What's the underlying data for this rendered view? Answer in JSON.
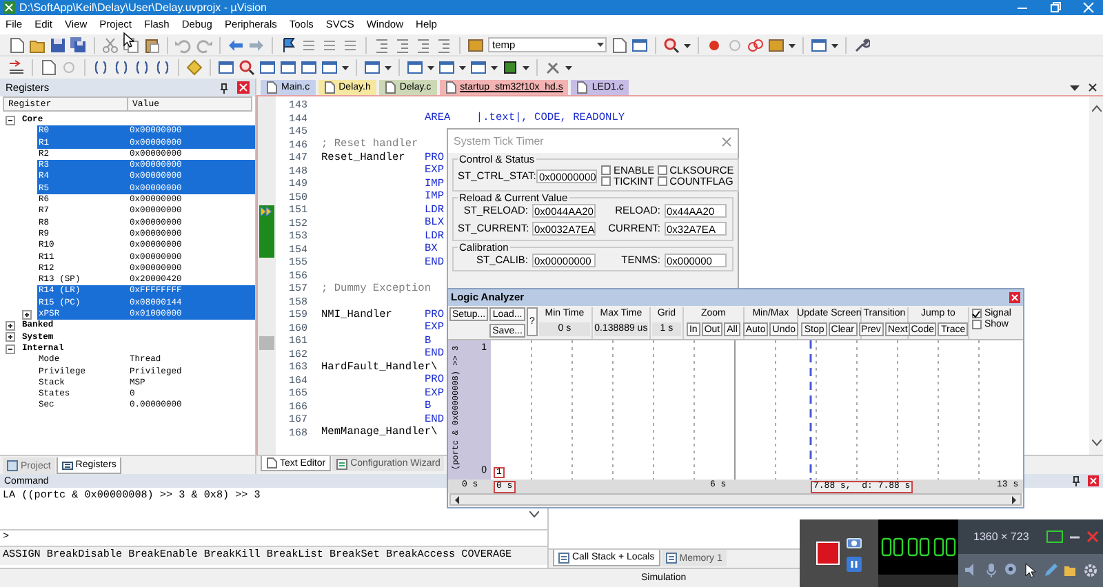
{
  "window": {
    "title": "D:\\SoftApp\\Keil\\Delay\\User\\Delay.uvprojx - µVision"
  },
  "menu": [
    "File",
    "Edit",
    "View",
    "Project",
    "Flash",
    "Debug",
    "Peripherals",
    "Tools",
    "SVCS",
    "Window",
    "Help"
  ],
  "toolbar": {
    "target": "temp"
  },
  "registers_panel": {
    "title": "Registers",
    "columns": [
      "Register",
      "Value"
    ],
    "tree": [
      {
        "name": "Core",
        "expanded": true,
        "selected": false,
        "children": [
          {
            "name": "R0",
            "value": "0x00000000",
            "selected": true
          },
          {
            "name": "R1",
            "value": "0x00000000",
            "selected": true
          },
          {
            "name": "R2",
            "value": "0x00000000",
            "selected": false
          },
          {
            "name": "R3",
            "value": "0x00000000",
            "selected": true
          },
          {
            "name": "R4",
            "value": "0x00000000",
            "selected": true
          },
          {
            "name": "R5",
            "value": "0x00000000",
            "selected": true
          },
          {
            "name": "R6",
            "value": "0x00000000",
            "selected": false
          },
          {
            "name": "R7",
            "value": "0x00000000",
            "selected": false
          },
          {
            "name": "R8",
            "value": "0x00000000",
            "selected": false
          },
          {
            "name": "R9",
            "value": "0x00000000",
            "selected": false
          },
          {
            "name": "R10",
            "value": "0x00000000",
            "selected": false
          },
          {
            "name": "R11",
            "value": "0x00000000",
            "selected": false
          },
          {
            "name": "R12",
            "value": "0x00000000",
            "selected": false
          },
          {
            "name": "R13 (SP)",
            "value": "0x20000420",
            "selected": false
          },
          {
            "name": "R14 (LR)",
            "value": "0xFFFFFFFF",
            "selected": true
          },
          {
            "name": "R15 (PC)",
            "value": "0x08000144",
            "selected": true
          },
          {
            "name": "xPSR",
            "value": "0x01000000",
            "selected": true,
            "expanded": false
          }
        ]
      },
      {
        "name": "Banked",
        "expanded": false,
        "selected": false
      },
      {
        "name": "System",
        "expanded": false,
        "selected": false
      },
      {
        "name": "Internal",
        "expanded": true,
        "selected": false,
        "children": [
          {
            "name": "Mode",
            "value": "Thread",
            "selected": false
          },
          {
            "name": "Privilege",
            "value": "Privileged",
            "selected": false
          },
          {
            "name": "Stack",
            "value": "MSP",
            "selected": false
          },
          {
            "name": "States",
            "value": "0",
            "selected": false
          },
          {
            "name": "Sec",
            "value": "0.00000000",
            "selected": false
          }
        ]
      }
    ],
    "tabs": [
      {
        "label": "Project",
        "selected": false
      },
      {
        "label": "Registers",
        "selected": true
      }
    ]
  },
  "editor": {
    "tabs": [
      {
        "label": "Main.c",
        "color": "#c5d1ec",
        "selected": false
      },
      {
        "label": "Delay.h",
        "color": "#f6e7a1",
        "selected": false
      },
      {
        "label": "Delay.c",
        "color": "#cdd8b6",
        "selected": false
      },
      {
        "label": "startup_stm32f10x_hd.s",
        "color": "#f3b3b3",
        "selected": true
      },
      {
        "label": "LED1.c",
        "color": "#c7bce6",
        "selected": false
      }
    ],
    "lines": [
      {
        "number": "143",
        "kind": "plain"
      },
      {
        "number": "144",
        "kind": "plain",
        "code": "AREA    |.text|, CODE, READONLY"
      },
      {
        "number": "145",
        "kind": "plain"
      },
      {
        "number": "146",
        "kind": "plain",
        "comment": "; Reset handler"
      },
      {
        "number": "147",
        "kind": "plain",
        "label": "Reset_Handler",
        "code": "PRO"
      },
      {
        "number": "148",
        "kind": "plain",
        "code": "EXP"
      },
      {
        "number": "149",
        "kind": "plain",
        "code": "IMP"
      },
      {
        "number": "150",
        "kind": "plain",
        "code": "IMP"
      },
      {
        "number": "151",
        "kind": "current",
        "code": "LDR"
      },
      {
        "number": "152",
        "kind": "executed",
        "code": "BLX"
      },
      {
        "number": "153",
        "kind": "executed",
        "code": "LDR"
      },
      {
        "number": "154",
        "kind": "executed",
        "code": "BX"
      },
      {
        "number": "155",
        "kind": "plain",
        "code": "END"
      },
      {
        "number": "156",
        "kind": "plain"
      },
      {
        "number": "157",
        "kind": "plain",
        "comment": "; Dummy Exception"
      },
      {
        "number": "158",
        "kind": "plain"
      },
      {
        "number": "159",
        "kind": "plain",
        "label": "NMI_Handler",
        "code": "PRO"
      },
      {
        "number": "160",
        "kind": "plain",
        "code": "EXP"
      },
      {
        "number": "161",
        "kind": "unexecuted",
        "code": "B"
      },
      {
        "number": "162",
        "kind": "plain",
        "code": "END"
      },
      {
        "number": "163",
        "kind": "plain",
        "label": "HardFault_Handler\\"
      },
      {
        "number": "164",
        "kind": "plain",
        "code": "PRO"
      },
      {
        "number": "165",
        "kind": "plain",
        "code": "EXP"
      },
      {
        "number": "166",
        "kind": "plain",
        "code": "B"
      },
      {
        "number": "167",
        "kind": "plain",
        "code": "END"
      },
      {
        "number": "168",
        "kind": "plain",
        "label": "MemManage_Handler\\"
      }
    ],
    "bottom_tabs": [
      {
        "label": "Text Editor",
        "selected": true
      },
      {
        "label": "Configuration Wizard",
        "selected": false
      }
    ]
  },
  "systick_dialog": {
    "title": "System Tick Timer",
    "control_status": {
      "title": "Control & Status",
      "label": "ST_CTRL_STAT:",
      "value": "0x00000000",
      "flags": [
        {
          "label": "ENABLE",
          "checked": false
        },
        {
          "label": "CLKSOURCE",
          "checked": false
        },
        {
          "label": "TICKINT",
          "checked": false
        },
        {
          "label": "COUNTFLAG",
          "checked": false
        }
      ]
    },
    "reload_current": {
      "title": "Reload & Current Value",
      "fields": [
        {
          "label": "ST_RELOAD:",
          "value": "0x0044AA20"
        },
        {
          "label": "RELOAD:",
          "value": "0x44AA20"
        },
        {
          "label": "ST_CURRENT:",
          "value": "0x0032A7EA"
        },
        {
          "label": "CURRENT:",
          "value": "0x32A7EA"
        }
      ]
    },
    "calibration": {
      "title": "Calibration",
      "fields": [
        {
          "label": "ST_CALIB:",
          "value": "0x00000000"
        },
        {
          "label": "TENMS:",
          "value": "0x000000"
        }
      ]
    }
  },
  "logic_analyzer": {
    "title": "Logic Analyzer",
    "setup": "Setup...",
    "load": "Load...",
    "save": "Save...",
    "help": "?",
    "readouts": [
      {
        "label": "Min Time",
        "value": "0 s"
      },
      {
        "label": "Max Time",
        "value": "0.138889 us"
      },
      {
        "label": "Grid",
        "value": "1 s"
      }
    ],
    "button_groups": [
      {
        "label": "Zoom",
        "buttons": [
          "In",
          "Out",
          "All"
        ]
      },
      {
        "label": "Min/Max",
        "buttons": [
          "Auto",
          "Undo"
        ]
      },
      {
        "label": "Update Screen",
        "buttons": [
          "Stop",
          "Clear"
        ]
      },
      {
        "label": "Transition",
        "buttons": [
          "Prev",
          "Next"
        ]
      },
      {
        "label": "Jump to",
        "buttons": [
          "Code",
          "Trace"
        ]
      }
    ],
    "options": [
      {
        "label": "Signal",
        "checked": true
      },
      {
        "label": "Show",
        "checked": false
      }
    ],
    "signal": {
      "name": "(portc & 0x00000008) >> 3",
      "max": "1",
      "min": "0"
    },
    "marker": "1",
    "axis": {
      "start": "0 s",
      "cursor_start": "0 s",
      "middle": "6 s",
      "cursor": "7.88 s,  d: 7.88 s",
      "end": "13 s"
    }
  },
  "command": {
    "title": "Command",
    "output": "LA ((portc & 0x00000008) >> 3 & 0x8) >> 3",
    "prompt": ">",
    "hints": "ASSIGN BreakDisable BreakEnable BreakKill BreakList BreakSet BreakAccess COVERAGE"
  },
  "watch_panel": {
    "tabs": [
      {
        "label": "Call Stack + Locals",
        "selected": true
      },
      {
        "label": "Memory 1",
        "selected": false
      }
    ]
  },
  "status_bar": {
    "mode": "Simulation"
  },
  "recorder": {
    "resolution": "1360 × 723"
  }
}
